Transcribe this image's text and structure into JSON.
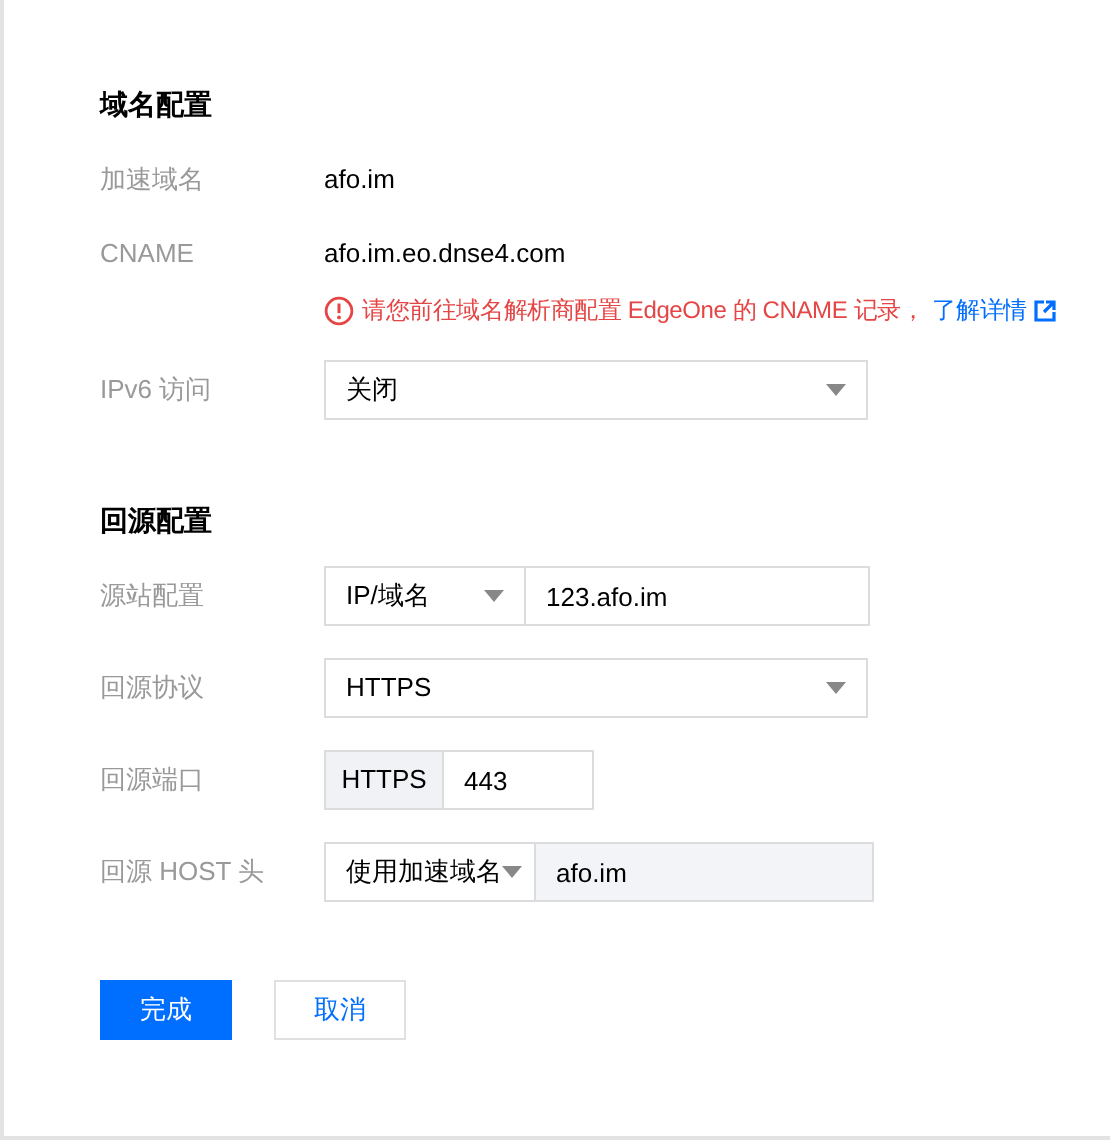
{
  "sections": [
    {
      "title": "域名配置",
      "fields": [
        {
          "label": "加速域名",
          "kind": "text",
          "value": "afo.im"
        },
        {
          "label": "CNAME",
          "kind": "text",
          "value": "afo.im.eo.dnse4.com",
          "note": {
            "text": "请您前往域名解析商配置 EdgeOne 的 CNAME 记录，",
            "link": "了解详情"
          }
        },
        {
          "label": "IPv6 访问",
          "kind": "select",
          "value": "关闭"
        }
      ]
    },
    {
      "title": "回源配置",
      "fields": [
        {
          "label": "源站配置",
          "kind": "select_input",
          "select": "IP/域名",
          "value": "123.afo.im"
        },
        {
          "label": "回源协议",
          "kind": "select",
          "value": "HTTPS"
        },
        {
          "label": "回源端口",
          "kind": "addon_input",
          "addon": "HTTPS",
          "value": "443"
        },
        {
          "label": "回源 HOST 头",
          "kind": "select_readonly",
          "select": "使用加速域名",
          "value": "afo.im"
        }
      ]
    }
  ],
  "buttons": [
    {
      "label": "完成",
      "kind": "primary"
    },
    {
      "label": "取消",
      "kind": "secondary"
    }
  ]
}
